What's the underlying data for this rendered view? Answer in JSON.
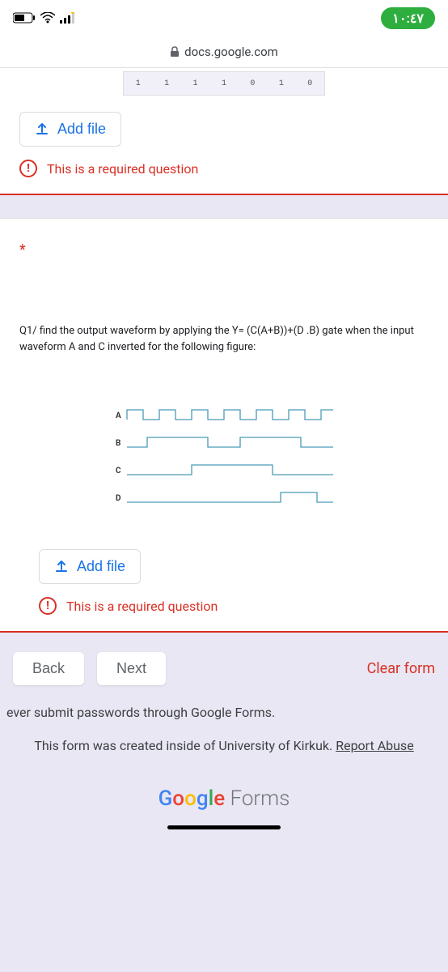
{
  "status": {
    "time": "١٠:٤٧"
  },
  "url": "docs.google.com",
  "add_file_label": "Add file",
  "error_text": "This is a required question",
  "question": {
    "asterisk": "*",
    "text": "Q1/ find  the output waveform by applying  the Y= (C(A+B))+(D .B) gate when the  input waveform A and C inverted for the  following figure:",
    "labels": {
      "A": "A",
      "B": "B",
      "C": "C",
      "D": "D"
    }
  },
  "nav": {
    "back": "Back",
    "next": "Next",
    "clear": "Clear form"
  },
  "footer": {
    "warning": "ever submit passwords through Google Forms.",
    "created": "This form was created inside of University of Kirkuk. ",
    "report": "Report Abuse",
    "forms": " Forms"
  },
  "table_fragment": {
    "cells": [
      "1",
      "1",
      "1",
      "1",
      "0",
      "1",
      "0"
    ]
  }
}
